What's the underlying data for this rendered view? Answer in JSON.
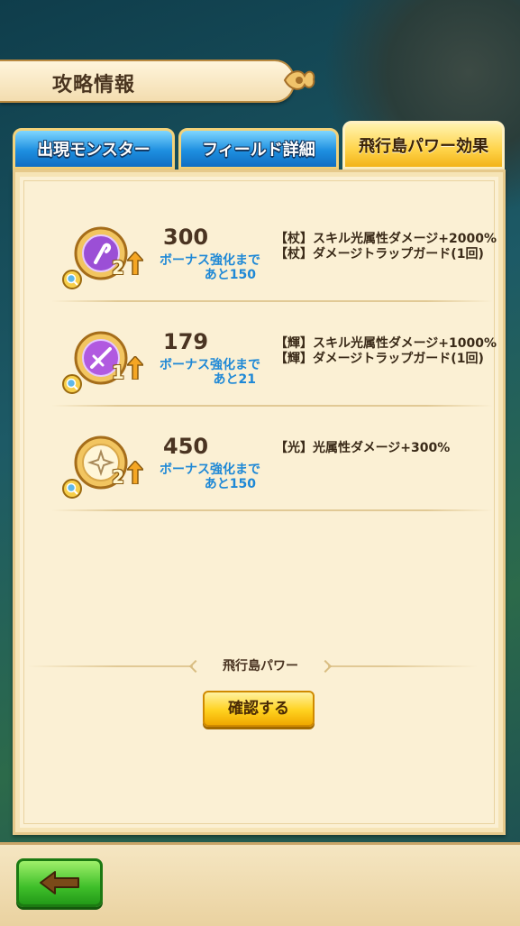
{
  "header": {
    "title": "攻略情報"
  },
  "tabs": [
    {
      "label": "出現モンスター",
      "active": false
    },
    {
      "label": "フィールド詳細",
      "active": false
    },
    {
      "label": "飛行島パワー効果",
      "active": true
    }
  ],
  "powers": [
    {
      "icon": "staff-medal-icon",
      "level": "2",
      "power": "300",
      "bonus_label": "ボーナス強化まで",
      "bonus_remain": "あと150",
      "effects": [
        "【杖】スキル光属性ダメージ+2000%",
        "【杖】ダメージトラップガード(1回)"
      ]
    },
    {
      "icon": "sword-medal-icon",
      "level": "1",
      "power": "179",
      "bonus_label": "ボーナス強化まで",
      "bonus_remain": "あと21",
      "effects": [
        "【輝】スキル光属性ダメージ+1000%",
        "【輝】ダメージトラップガード(1回)"
      ]
    },
    {
      "icon": "light-medal-icon",
      "level": "2",
      "power": "450",
      "bonus_label": "ボーナス強化まで",
      "bonus_remain": "あと150",
      "effects": [
        "【光】光属性ダメージ+300%"
      ]
    }
  ],
  "footer_section": {
    "title": "飛行島パワー",
    "confirm_label": "確認する"
  },
  "colors": {
    "accent_blue": "#1e88d6",
    "tab_active": "#ffd44a",
    "tab_inactive": "#1e8fe0",
    "back_button": "#3fbf2a"
  }
}
